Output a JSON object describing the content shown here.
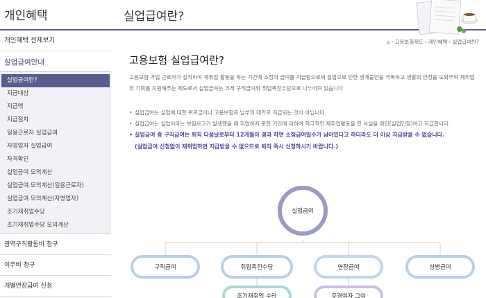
{
  "sidebar": {
    "title": "개인혜택",
    "overview_link": "개인혜택 전체보기",
    "section_title": "실업급여안내",
    "sub_items": [
      {
        "label": "실업급여란?",
        "active": true
      },
      {
        "label": "지급대상"
      },
      {
        "label": "지급액"
      },
      {
        "label": "지급절차"
      },
      {
        "label": "일용근로자 실업급여"
      },
      {
        "label": "자영업자 실업급여"
      },
      {
        "label": "자격확인"
      },
      {
        "label": "실업급여 모의계산"
      },
      {
        "label": "실업급여 모의계산(일용근로자)"
      },
      {
        "label": "실업급여 모의계산(자영업자)"
      },
      {
        "label": "조기재취업수당"
      },
      {
        "label": "조기재취업수당 모의계산"
      }
    ],
    "bottom_links": [
      "광역구직활동비 청구",
      "이주비 청구",
      "개별연장급여 신청"
    ]
  },
  "header": {
    "title": "실업급여란?"
  },
  "breadcrumb": {
    "items": [
      "고용보험제도",
      "개인혜택",
      "실업급여란?"
    ]
  },
  "main": {
    "heading": "고용보험 실업급여란?",
    "intro": "고용보험 가입 근로자가 실직하여 재취업 활동을 하는 기간에 소정의 급여를 지급함으로써 실업으로 인한 생계불안을 극복하고 생활의 안정을 도와주며 재취업의 기회를 지원해주는 제도로서 실업급여는 크게 구직급여와 취업촉진수당으로 나누어져 있습니다.",
    "bullets": [
      "실업급여는 실업에 대한 위로금이나 고용보험료 납부의 대가로 지급되는 것이 아닙니다.",
      "실업급여는 실업이라는 보험사고가 발생했을 때 취업하지 못한 기간에 대하여 적극적인 재취업활동을 한 사실을 확인(실업인정)하고 지급합니다."
    ],
    "emphasis": "실업급여 중 구직급여는 퇴직 다음날로부터 12개월이 경과 하면 소정급여일수가 남아있다고 하더라도 더 이상 지급받을 수 없습니다.",
    "note": "(실업급여 신청없이 재취업하면 지급받을 수 없으므로 퇴직 즉시 신청하시기 바랍니다.)"
  },
  "diagram": {
    "center": "실업급여",
    "level1": [
      "구직급여",
      "취업촉진수당",
      "연장급여",
      "상병급여"
    ],
    "level2": [
      "조기재취업 수당",
      "후경여자 그여"
    ]
  },
  "colors": {
    "accent": "#5b5b8f",
    "circle": "#9a9ac8",
    "pill": "#b8d0e6",
    "emphasis": "#4a4a9a"
  }
}
